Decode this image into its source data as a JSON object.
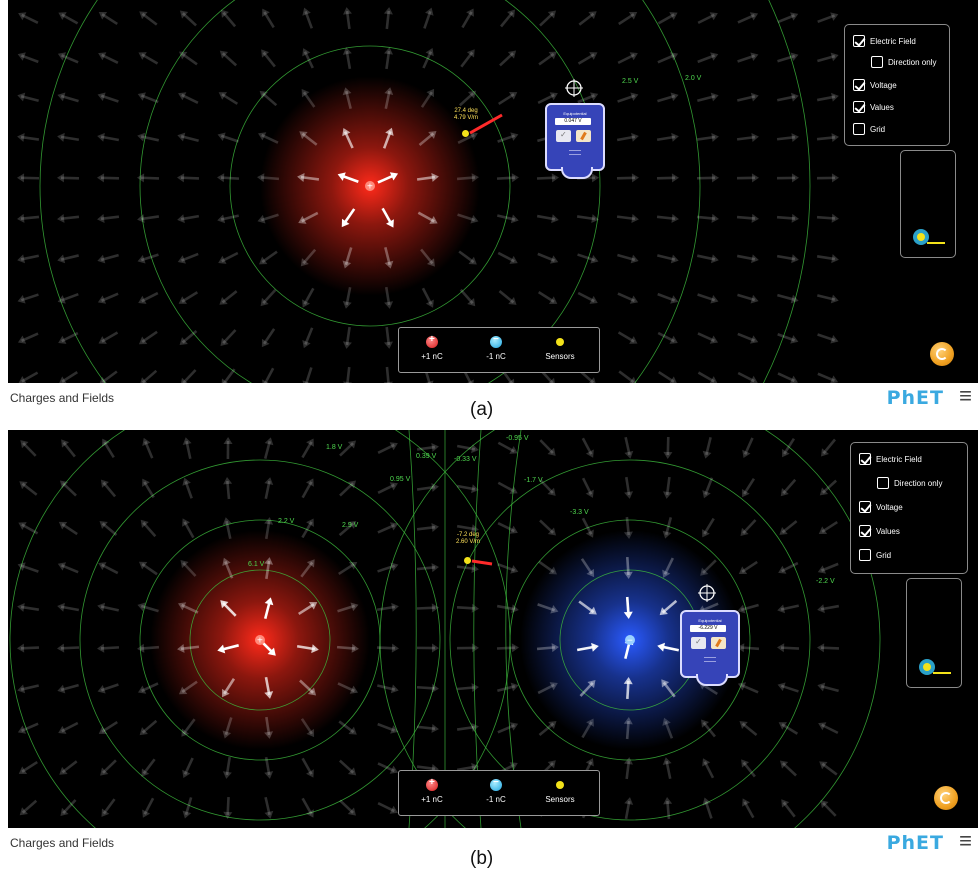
{
  "panels": [
    {
      "id": "a",
      "app_title": "Charges and Fields",
      "caption": "(a)",
      "controls": {
        "electric_field": {
          "label": "Electric Field",
          "checked": true
        },
        "direction_only": {
          "label": "Direction only",
          "checked": false
        },
        "voltage": {
          "label": "Voltage",
          "checked": true
        },
        "values": {
          "label": "Values",
          "checked": true
        },
        "grid": {
          "label": "Grid",
          "checked": false
        }
      },
      "toolbox": {
        "positive_label": "+1 nC",
        "negative_label": "-1 nC",
        "sensors_label": "Sensors"
      },
      "sensor": {
        "angle": "27.4 deg",
        "magnitude": "4.79 V/m"
      },
      "voltmeter": {
        "title": "Equipotential",
        "value": "0.047 V"
      },
      "voltage_labels": [
        "2.5 V",
        "2.0 V"
      ],
      "charges": [
        {
          "sign": "positive",
          "color": "#ff2a1a"
        }
      ]
    },
    {
      "id": "b",
      "app_title": "Charges and Fields",
      "caption": "(b)",
      "controls": {
        "electric_field": {
          "label": "Electric Field",
          "checked": true
        },
        "direction_only": {
          "label": "Direction only",
          "checked": false
        },
        "voltage": {
          "label": "Voltage",
          "checked": true
        },
        "values": {
          "label": "Values",
          "checked": true
        },
        "grid": {
          "label": "Grid",
          "checked": false
        }
      },
      "toolbox": {
        "positive_label": "+1 nC",
        "negative_label": "-1 nC",
        "sensors_label": "Sensors"
      },
      "sensor": {
        "angle": "-7.2 deg",
        "magnitude": "2.60 V/m"
      },
      "voltmeter": {
        "title": "Equipotential",
        "value": "-6.229 V"
      },
      "voltage_labels": [
        "1.8 V",
        "0.39 V",
        "-0.33 V",
        "-0.95 V",
        "0.95 V",
        "-1.7 V",
        "2.2 V",
        "2.9 V",
        "-3.3 V",
        "6.1 V",
        "-2.2 V"
      ],
      "charges": [
        {
          "sign": "positive",
          "color": "#ff2a1a"
        },
        {
          "sign": "negative",
          "color": "#2a5aff"
        }
      ]
    }
  ],
  "branding": {
    "logo_text": "PhET",
    "logo_color": "#3aa9e0",
    "accent_orange": "#f0a020"
  },
  "icons": [
    "checkbox-icon",
    "tape-measure-icon",
    "reset-icon",
    "menu-icon",
    "crosshair-icon"
  ]
}
